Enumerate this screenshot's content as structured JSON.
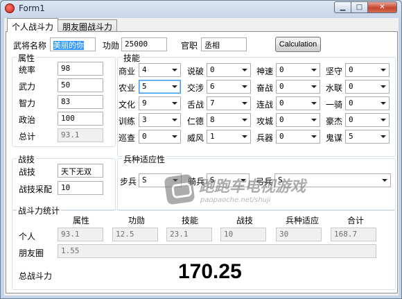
{
  "window": {
    "title": "Form1"
  },
  "tabs": [
    {
      "label": "个人战斗力"
    },
    {
      "label": "朋友圈战斗力"
    }
  ],
  "general": {
    "name_label": "武将名称",
    "name_value": "美丽的你",
    "merit_label": "功勋",
    "merit_value": "25000",
    "rank_label": "官职",
    "rank_value": "丞相",
    "calc_button": "Calculation"
  },
  "attributes": {
    "title": "属性",
    "items": [
      {
        "label": "统率",
        "value": "98"
      },
      {
        "label": "武力",
        "value": "50"
      },
      {
        "label": "智力",
        "value": "83"
      },
      {
        "label": "政治",
        "value": "100"
      },
      {
        "label": "总计",
        "value": "93.1"
      }
    ]
  },
  "skills": {
    "title": "技能",
    "items": [
      {
        "label": "商业",
        "value": "4"
      },
      {
        "label": "说破",
        "value": "0"
      },
      {
        "label": "神速",
        "value": "0"
      },
      {
        "label": "坚守",
        "value": "0"
      },
      {
        "label": "农业",
        "value": "5"
      },
      {
        "label": "交涉",
        "value": "6"
      },
      {
        "label": "奋战",
        "value": "0"
      },
      {
        "label": "水联",
        "value": "0"
      },
      {
        "label": "文化",
        "value": "9"
      },
      {
        "label": "舌战",
        "value": "7"
      },
      {
        "label": "连战",
        "value": "0"
      },
      {
        "label": "一骑",
        "value": "0"
      },
      {
        "label": "训练",
        "value": "3"
      },
      {
        "label": "仁德",
        "value": "8"
      },
      {
        "label": "攻城",
        "value": "0"
      },
      {
        "label": "豪杰",
        "value": "0"
      },
      {
        "label": "巡查",
        "value": "0"
      },
      {
        "label": "威风",
        "value": "1"
      },
      {
        "label": "兵器",
        "value": "0"
      },
      {
        "label": "鬼谋",
        "value": "5"
      }
    ]
  },
  "tactics": {
    "title": "战技",
    "skill_label": "战技",
    "skill_value": "天下无双",
    "adopt_label": "战技采配",
    "adopt_value": "10"
  },
  "troops": {
    "title": "兵种适应性",
    "items": [
      {
        "label": "步兵",
        "value": "S"
      },
      {
        "label": "骑兵",
        "value": "S"
      },
      {
        "label": "弓兵",
        "value": "S"
      }
    ]
  },
  "stats": {
    "title": "战斗力统计",
    "columns": [
      "属性",
      "功勋",
      "技能",
      "战技",
      "兵种适应",
      "合计"
    ],
    "personal_label": "个人",
    "personal_values": [
      "93.1",
      "12.5",
      "23.1",
      "10",
      "30",
      "168.7"
    ],
    "friends_label": "朋友圈",
    "friends_value": "1.55",
    "total_label": "总战斗力",
    "total_value": "170.25"
  },
  "watermark": {
    "text": "跑跑车电视游戏",
    "url": "paopaoche.net/shuji"
  }
}
